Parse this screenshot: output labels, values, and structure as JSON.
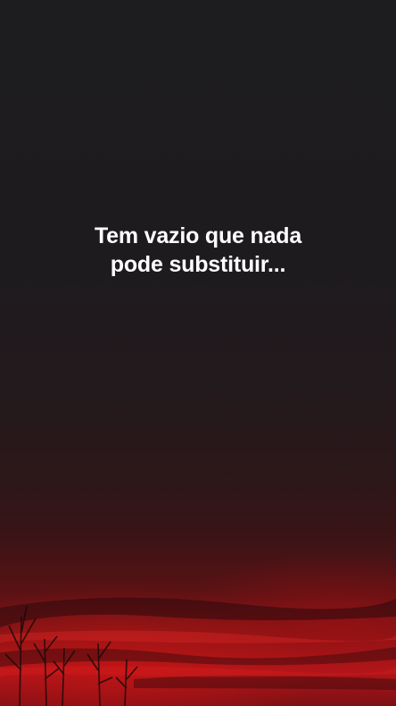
{
  "story": {
    "text_lines": [
      "Tem vazio que nada",
      "pode substituir..."
    ],
    "colors": {
      "sky_dark": "#1d1c1f",
      "sunset_red": "#b3161a",
      "text": "#ffffff"
    },
    "background_image": "red sunset sky with bare tree silhouettes"
  }
}
